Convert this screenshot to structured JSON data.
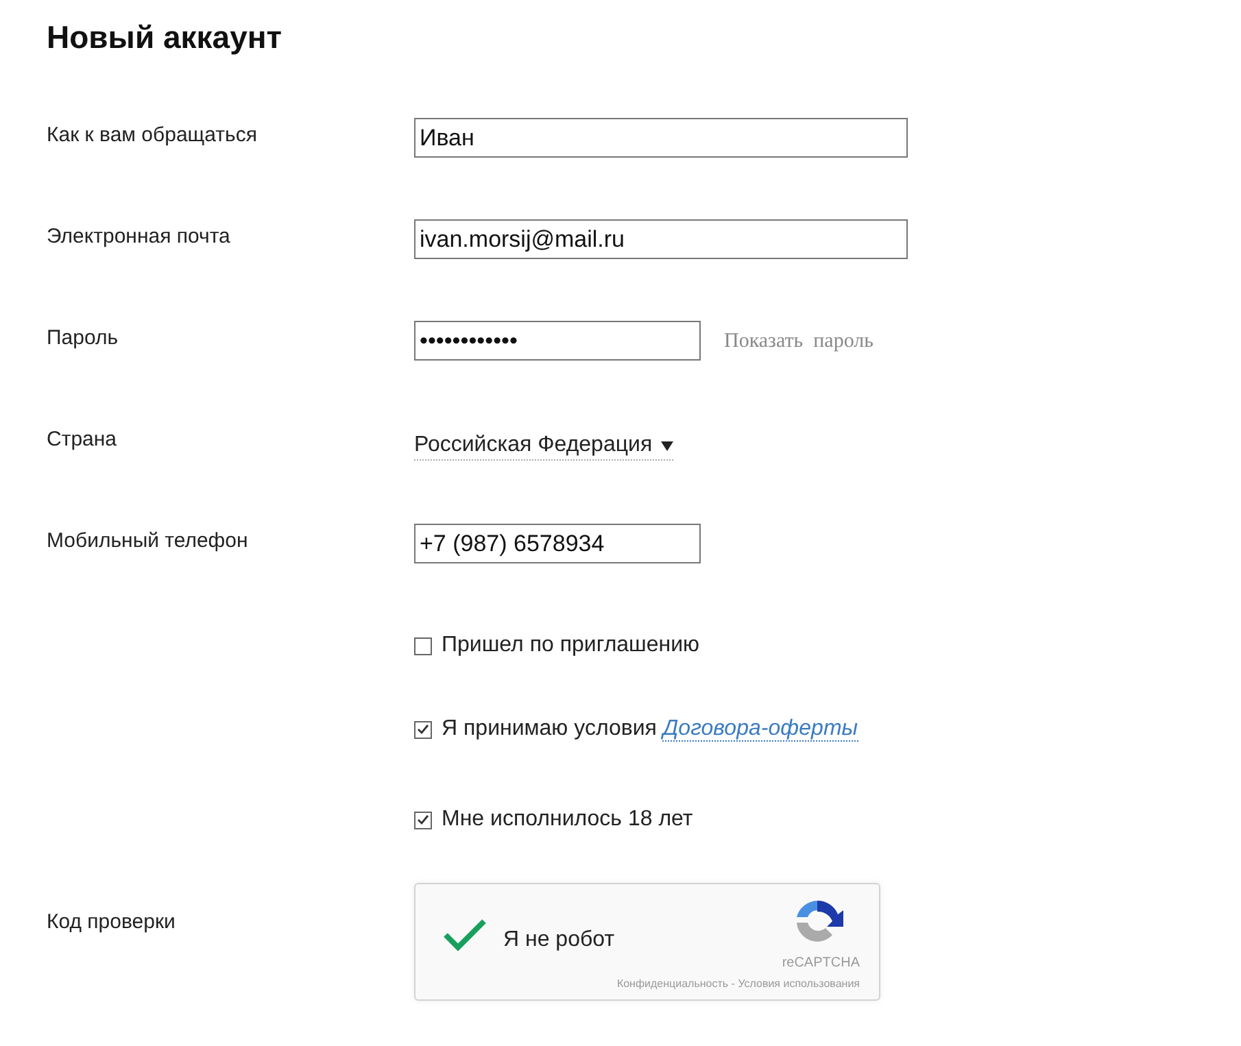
{
  "title": "Новый аккаунт",
  "fields": [
    {
      "kind": "text",
      "label": "Как к вам обращаться",
      "value": "Иван",
      "wide": true
    },
    {
      "kind": "text",
      "label": "Электронная почта",
      "value": "ivan.morsij@mail.ru",
      "wide": true
    },
    {
      "kind": "password",
      "label": "Пароль",
      "value": "••••••••••••",
      "action": "Показать  пароль",
      "wide": false
    },
    {
      "kind": "select",
      "label": "Страна",
      "value": "Российская Федерация"
    },
    {
      "kind": "text",
      "label": "Мобильный телефон",
      "value": "+7 (987) 6578934",
      "wide": false
    }
  ],
  "checkboxes": [
    {
      "text": "Пришел по приглашению",
      "checked": false
    },
    {
      "text": "Я принимаю условия",
      "link": "Договора-оферты",
      "checked": true
    },
    {
      "text": "Мне исполнилось 18 лет",
      "checked": true
    }
  ],
  "captcha": {
    "label": "Код проверки",
    "text": "Я не робот",
    "checked": true,
    "brand": "reCAPTCHA",
    "footer": "Конфиденциальность - Условия использования"
  }
}
